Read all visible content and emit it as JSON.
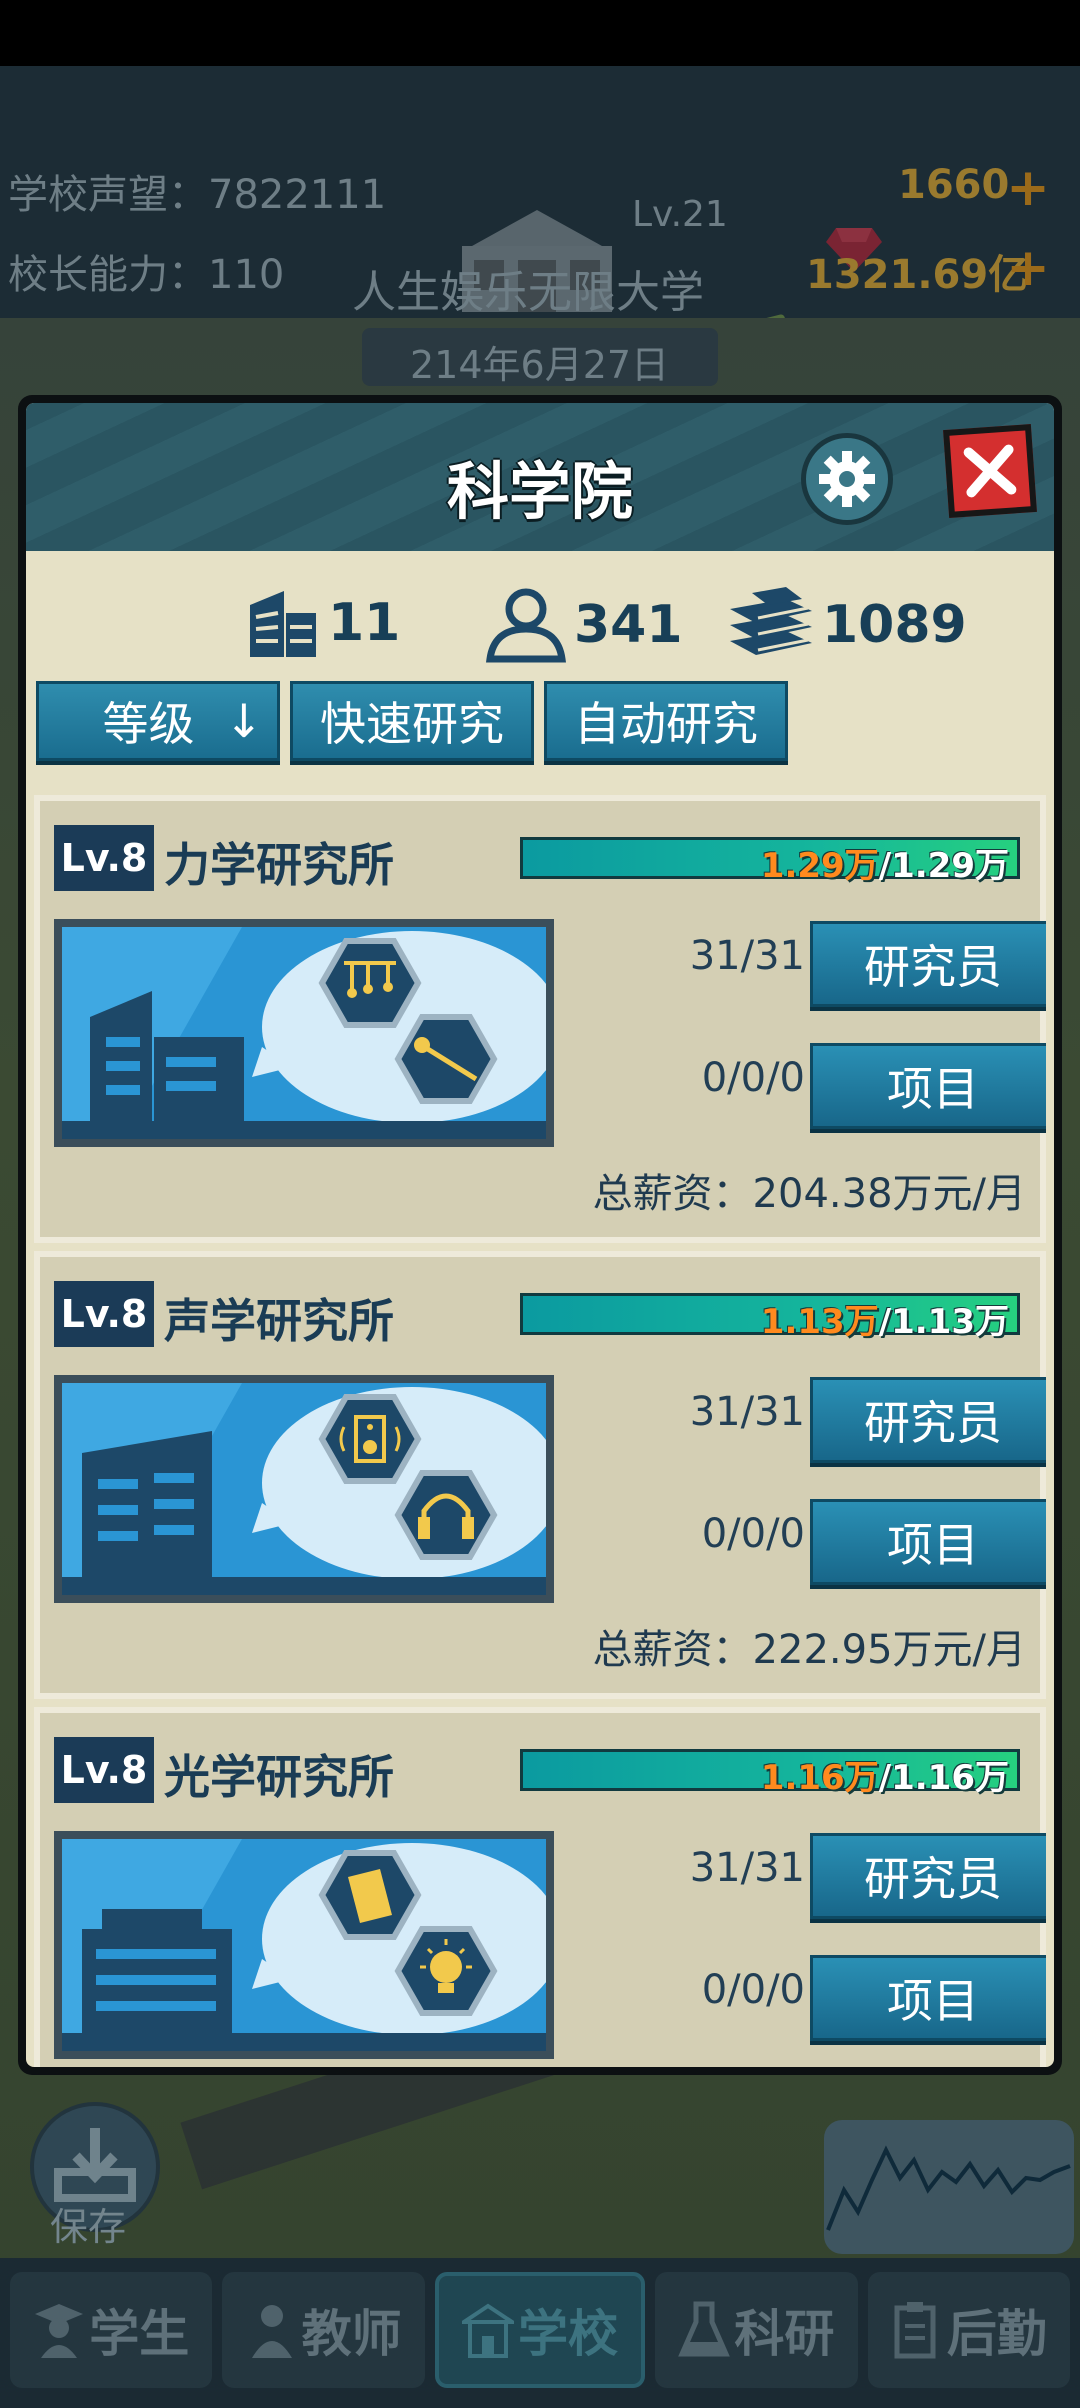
{
  "hud": {
    "reputation_label": "学校声望：7822111",
    "ability_label": "校长能力：110",
    "school_level": "Lv.21",
    "school_name": "人生娱乐无限大学",
    "gems": "1660",
    "money": "1321.69亿",
    "date": "214年6月27日"
  },
  "modal": {
    "title": "科学院",
    "stats": {
      "buildings": "11",
      "people": "341",
      "books": "1089"
    },
    "filters": {
      "sort_label": "等级",
      "sort_arrow": "↓",
      "quick": "快速研究",
      "auto": "自动研究"
    },
    "institutes": [
      {
        "level": "Lv.8",
        "name": "力学研究所",
        "progress_current": "1.29万",
        "progress_total": "/1.29万",
        "progress_fraction": 1.0,
        "researchers": "31/31",
        "researchers_btn": "研究员",
        "projects": "0/0/0",
        "projects_btn": "项目",
        "salary": "总薪资：204.38万元/月",
        "icons": [
          "pendulum-icon",
          "pin-icon"
        ]
      },
      {
        "level": "Lv.8",
        "name": "声学研究所",
        "progress_current": "1.13万",
        "progress_total": "/1.13万",
        "progress_fraction": 1.0,
        "researchers": "31/31",
        "researchers_btn": "研究员",
        "projects": "0/0/0",
        "projects_btn": "项目",
        "salary": "总薪资：222.95万元/月",
        "icons": [
          "speaker-icon",
          "headphones-icon"
        ]
      },
      {
        "level": "Lv.8",
        "name": "光学研究所",
        "progress_current": "1.16万",
        "progress_total": "/1.16万",
        "progress_fraction": 1.0,
        "researchers": "31/31",
        "researchers_btn": "研究员",
        "projects": "0/0/0",
        "projects_btn": "项目",
        "icons": [
          "prism-icon",
          "lightbulb-icon"
        ]
      }
    ]
  },
  "bottom": {
    "save_label": "保存",
    "tabs": [
      "学生",
      "教师",
      "学校",
      "科研",
      "后勤"
    ],
    "active_tab": "学校"
  },
  "colors": {
    "accent": "#1a6d8f",
    "panel": "#e6e1c6",
    "progress_current": "#ff8a1e"
  }
}
